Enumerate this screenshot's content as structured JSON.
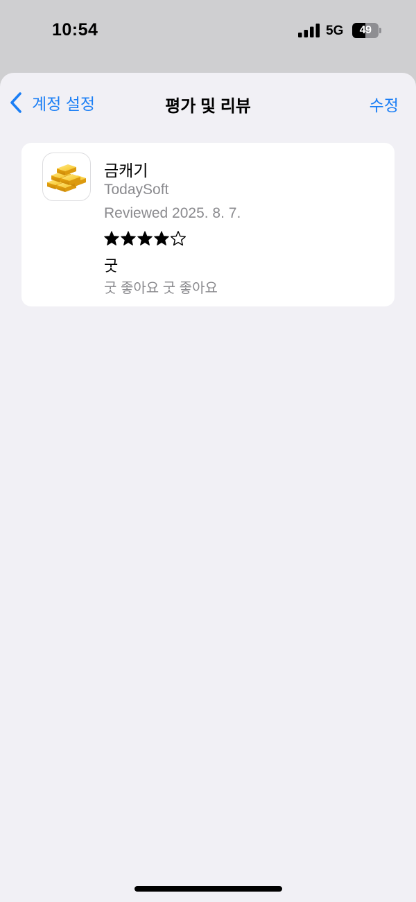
{
  "status_bar": {
    "time": "10:54",
    "network": "5G",
    "battery_level": "49",
    "battery_fraction": 0.49,
    "signal_bars": 4
  },
  "nav": {
    "back_label": "계정 설정",
    "title": "평가 및 리뷰",
    "edit_label": "수정"
  },
  "review": {
    "app_name": "금캐기",
    "developer": "TodaySoft",
    "reviewed_date": "Reviewed 2025. 8. 7.",
    "rating": 4,
    "rating_max": 5,
    "title": "굿",
    "body": "굿 좋아요 굿 좋아요"
  },
  "colors": {
    "accent": "#1a7ef5",
    "secondary_text": "#8a8a8e",
    "background": "#f1f0f5",
    "card": "#ffffff"
  },
  "icons": {
    "back": "chevron-left-icon",
    "app": "gold-bars-icon",
    "signal": "cellular-signal-icon",
    "battery": "battery-icon"
  }
}
